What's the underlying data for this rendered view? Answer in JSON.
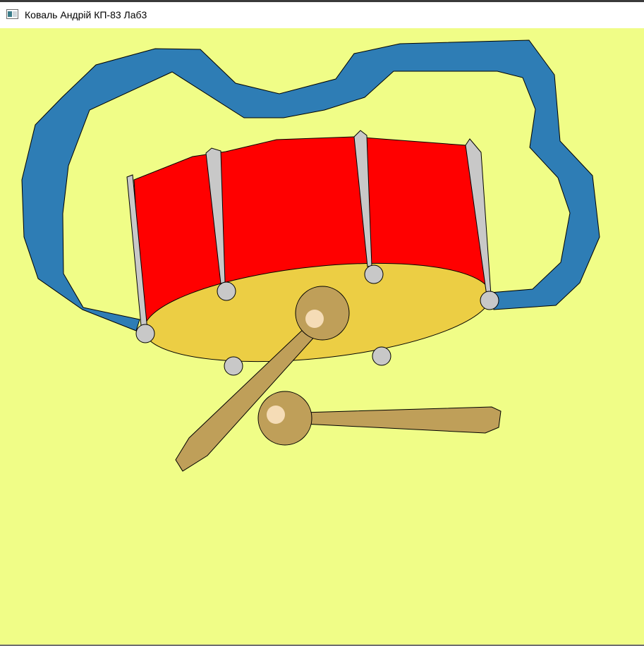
{
  "window": {
    "title": "Коваль Андрій КП-83 Лаб3",
    "icon": "window-app-icon"
  },
  "scene": {
    "description_visible": false,
    "colors": {
      "background": "#f0fd87",
      "rope": "#2e7db5",
      "drum_shell": "#ff0000",
      "drum_head": "#ecce44",
      "metal": "#c8c8c8",
      "stick": "#bf9f59",
      "stick_tip_highlight": "#f5dcb6",
      "outline": "#000000"
    },
    "objects": [
      "drum",
      "rope-strap",
      "left-drumstick",
      "right-drumstick"
    ]
  }
}
